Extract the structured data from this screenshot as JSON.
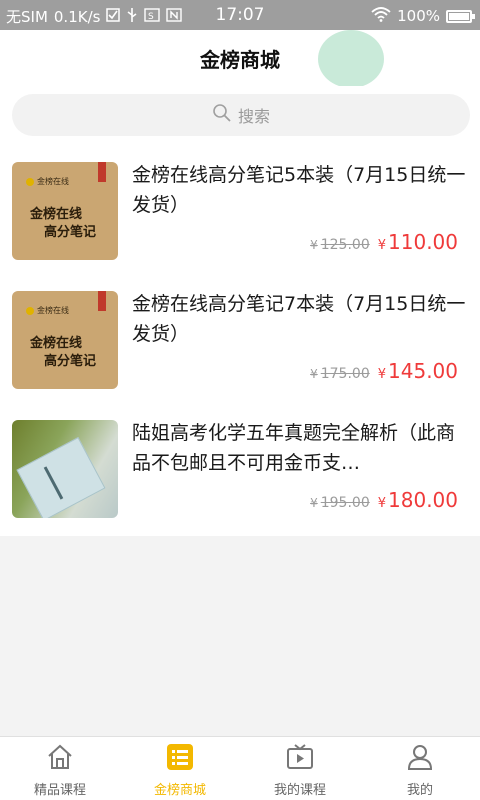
{
  "status_bar": {
    "carrier": "无SIM",
    "speed": "0.1K/s",
    "time": "17:07",
    "battery": "100%"
  },
  "header": {
    "title": "金榜商城"
  },
  "search": {
    "placeholder": "搜索"
  },
  "products": [
    {
      "name": "金榜在线高分笔记5本装（7月15日统一发货）",
      "old_price": "125.00",
      "price": "110.00",
      "currency": "¥",
      "cover_line1": "金榜在线",
      "cover_line2": "高分笔记"
    },
    {
      "name": "金榜在线高分笔记7本装（7月15日统一发货）",
      "old_price": "175.00",
      "price": "145.00",
      "currency": "¥",
      "cover_line1": "金榜在线",
      "cover_line2": "高分笔记"
    },
    {
      "name": "陆姐高考化学五年真题完全解析（此商品不包邮且不可用金币支…",
      "old_price": "195.00",
      "price": "180.00",
      "currency": "¥"
    }
  ],
  "tabs": [
    {
      "label": "精品课程",
      "icon": "home-icon"
    },
    {
      "label": "金榜商城",
      "icon": "list-icon"
    },
    {
      "label": "我的课程",
      "icon": "tv-icon"
    },
    {
      "label": "我的",
      "icon": "user-icon"
    }
  ],
  "colors": {
    "accent": "#f3b800",
    "price": "#ef3a3a"
  }
}
